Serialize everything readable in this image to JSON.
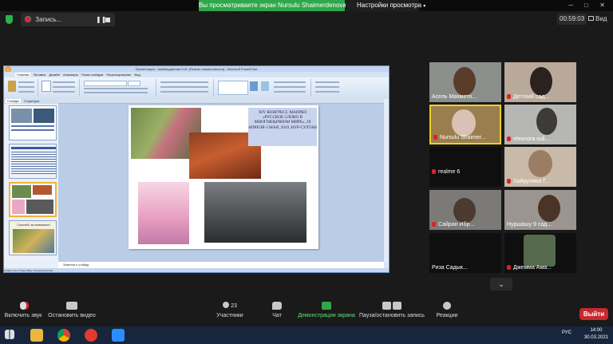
{
  "top_bar": {
    "share_banner": "Вы просматриваете экран Nursulu Shaimerdenova",
    "view_settings": "Настройки просмотра",
    "window_controls": "─ □ ✕"
  },
  "record_panel": {
    "label": "Запись...",
    "pause_icon": "pause-icon",
    "stop_icon": "stop-icon"
  },
  "timer": "00:59:03",
  "view_button": "Вид",
  "ppt": {
    "window_title": "Презентация - Шаймердинова Н.Ж. [Режим совместимости] - Microsoft PowerPoint",
    "tabs": [
      "Главная",
      "Вставка",
      "Дизайн",
      "Анимация",
      "Показ слайдов",
      "Рецензирование",
      "Вид"
    ],
    "thumb_tabs": [
      "Слайды",
      "Структура"
    ],
    "thumb4_text": "Спасибо за внимание!",
    "notes_placeholder": "Заметки к слайду",
    "status": "Слайд 3 из 4   \"Тема Office\"   Русский (Россия)",
    "slide_title": "XIV КОНГРЕСС МАПРЯЛ «РУССКОЕ СЛОВО В МНОГОЯЗЫЧНОМ МИРЕ», 29 АПРЕЛЯ-3 МАЯ, 2019, НУР-СУЛТАН"
  },
  "participants": [
    {
      "name": "Асель Махмето...",
      "muted": false
    },
    {
      "name": "Детский сад...",
      "muted": true
    },
    {
      "name": "Nursulu Shaimer...",
      "muted": true,
      "active": true
    },
    {
      "name": "eleonora suli...",
      "muted": true
    },
    {
      "name": "realme 6",
      "muted": true
    },
    {
      "name": "Хайрулина Г...",
      "muted": true
    },
    {
      "name": "Сайран Ибр...",
      "muted": true
    },
    {
      "name": "Нуршашу 9 сад...",
      "muted": false
    },
    {
      "name": "Риза Садык...",
      "muted": false
    },
    {
      "name": "Джемма Ама...",
      "muted": true
    }
  ],
  "gallery_down_icon": "chevron-down-icon",
  "toolbar": {
    "unmute": "Включить звук",
    "video": "Остановить видео",
    "participants": "Участники",
    "participants_count": "23",
    "chat": "Чат",
    "share": "Демонстрация экрана",
    "record": "Пауза/остановить запись",
    "reactions": "Реакции",
    "leave": "Выйти"
  },
  "taskbar": {
    "time": "14:00",
    "date": "30.03.2021",
    "lang": "РУС"
  },
  "colors": {
    "share_green": "#2ea84a",
    "leave_red": "#c8282f",
    "active_speaker": "#e9d229"
  }
}
